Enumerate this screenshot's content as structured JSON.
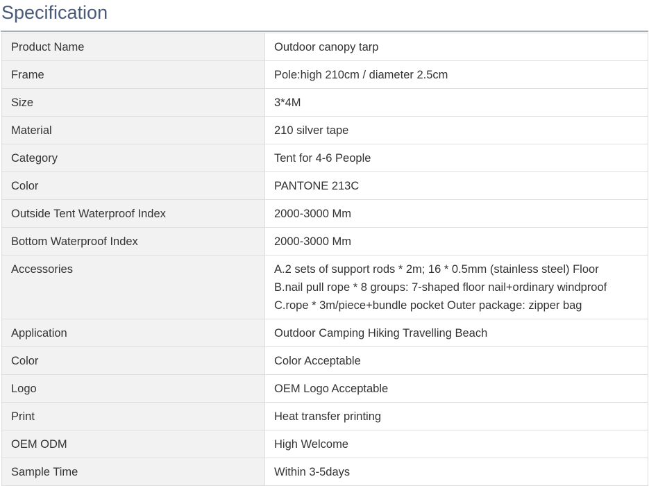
{
  "title": "Specification",
  "rows": [
    {
      "label": "Product Name",
      "value": [
        "Outdoor canopy tarp"
      ]
    },
    {
      "label": "Frame",
      "value": [
        "Pole:high 210cm / diameter 2.5cm"
      ]
    },
    {
      "label": "Size",
      "value": [
        "3*4M"
      ]
    },
    {
      "label": "Material",
      "value": [
        "210 silver tape"
      ]
    },
    {
      "label": "Category",
      "value": [
        "Tent for 4-6 People"
      ]
    },
    {
      "label": "Color",
      "value": [
        "PANTONE 213C"
      ]
    },
    {
      "label": "Outside Tent Waterproof Index",
      "value": [
        "2000-3000 Mm"
      ]
    },
    {
      "label": "Bottom Waterproof Index",
      "value": [
        "2000-3000 Mm"
      ]
    },
    {
      "label": "Accessories",
      "value": [
        "A.2 sets of support rods * 2m; 16 * 0.5mm (stainless steel) Floor",
        "B.nail pull rope * 8 groups: 7-shaped floor nail+ordinary windproof",
        "C.rope * 3m/piece+bundle pocket Outer package: zipper bag"
      ]
    },
    {
      "label": "Application",
      "value": [
        "Outdoor Camping Hiking Travelling Beach"
      ]
    },
    {
      "label": "Color",
      "value": [
        "Color Acceptable"
      ]
    },
    {
      "label": "Logo",
      "value": [
        "OEM Logo Acceptable"
      ]
    },
    {
      "label": "Print",
      "value": [
        "Heat transfer printing"
      ]
    },
    {
      "label": "OEM ODM",
      "value": [
        "High Welcome"
      ]
    },
    {
      "label": "Sample Time",
      "value": [
        "Within 3-5days"
      ]
    }
  ]
}
